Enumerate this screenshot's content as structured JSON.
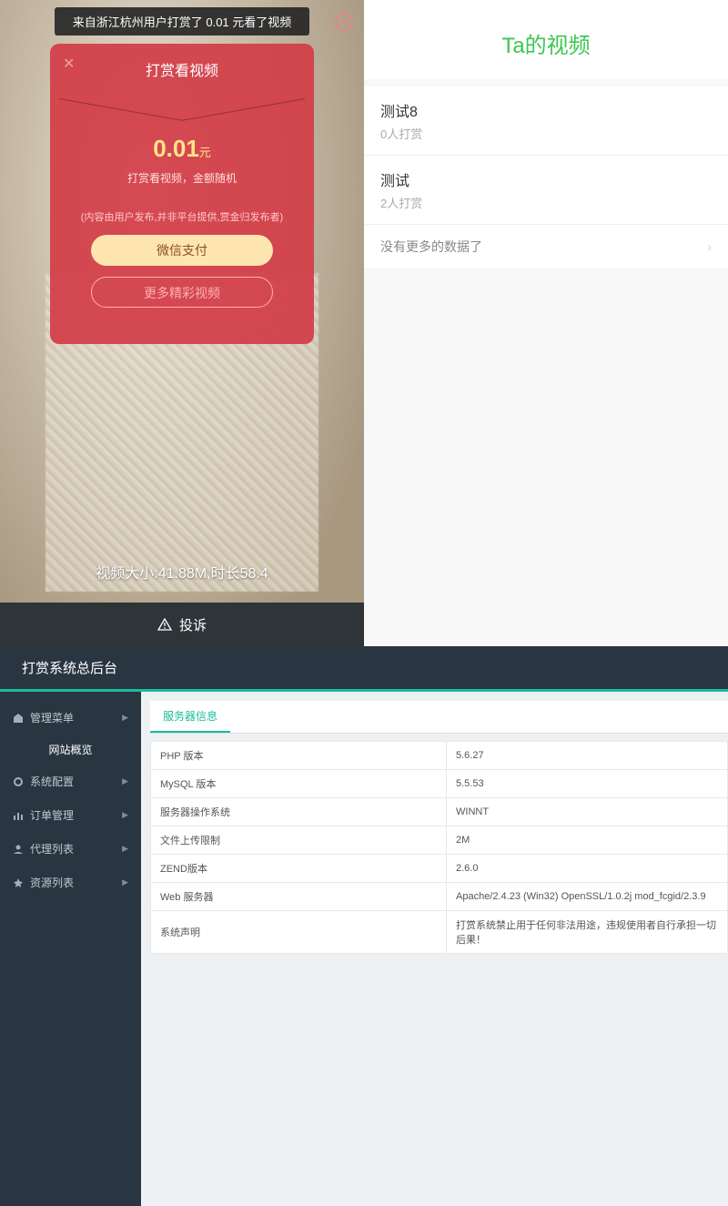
{
  "mobile": {
    "toast": "来自浙江杭州用户打赏了 0.01 元看了视频",
    "modal": {
      "title": "打赏看视频",
      "amount": "0.01",
      "amount_unit": "元",
      "subtitle": "打赏看视频，金额随机",
      "note": "(内容由用户发布,并非平台提供,赏金归发布者)",
      "pay_btn": "微信支付",
      "more_btn": "更多精彩视频"
    },
    "video_info": "视频大小:41.88M,时长58.4",
    "complain": "投诉"
  },
  "list": {
    "title": "Ta的视频",
    "items": [
      {
        "name": "测试8",
        "meta": "0人打赏"
      },
      {
        "name": "测试",
        "meta": "2人打赏"
      }
    ],
    "no_more": "没有更多的数据了"
  },
  "admin": {
    "header": "打赏系统总后台",
    "sidebar": [
      {
        "label": "管理菜单",
        "icon": "home"
      },
      {
        "label": "网站概览",
        "active": true
      },
      {
        "label": "系统配置",
        "icon": "cog"
      },
      {
        "label": "订单管理",
        "icon": "chart"
      },
      {
        "label": "代理列表",
        "icon": "user"
      },
      {
        "label": "资源列表",
        "icon": "star"
      }
    ],
    "tab": "服务器信息",
    "table": [
      {
        "k": "PHP 版本",
        "v": "5.6.27"
      },
      {
        "k": "MySQL 版本",
        "v": "5.5.53"
      },
      {
        "k": "服务器操作系统",
        "v": "WINNT"
      },
      {
        "k": "文件上传限制",
        "v": "2M"
      },
      {
        "k": "ZEND版本",
        "v": "2.6.0"
      },
      {
        "k": "Web 服务器",
        "v": "Apache/2.4.23 (Win32) OpenSSL/1.0.2j mod_fcgid/2.3.9"
      },
      {
        "k": "系统声明",
        "v": "打赏系统禁止用于任何非法用途，违规使用者自行承担一切后果！"
      }
    ]
  }
}
